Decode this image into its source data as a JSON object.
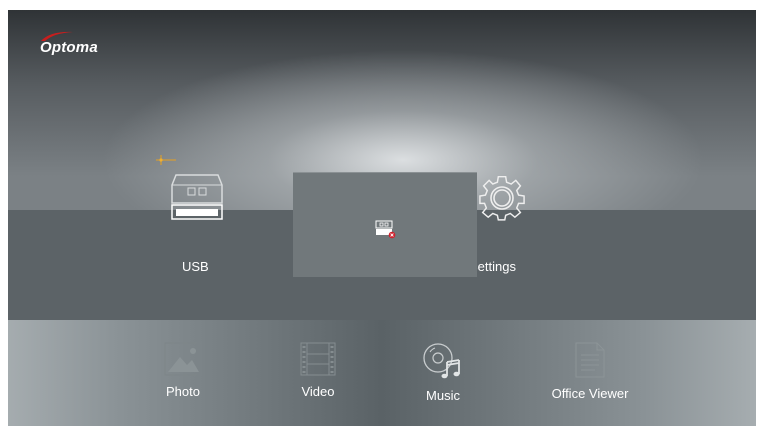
{
  "brand": {
    "name": "Optoma",
    "accent": "#c81e1e"
  },
  "tiles": {
    "usb": {
      "label": "USB",
      "icon": "usb-drive-icon"
    },
    "settings": {
      "label": "Settings",
      "icon": "gear-icon"
    }
  },
  "popup": {
    "icon": "usb-disconnected-icon"
  },
  "apps": [
    {
      "label": "Photo",
      "icon": "photo-icon"
    },
    {
      "label": "Video",
      "icon": "film-strip-icon"
    },
    {
      "label": "Music",
      "icon": "music-disc-icon"
    },
    {
      "label": "Office Viewer",
      "icon": "document-icon"
    }
  ]
}
